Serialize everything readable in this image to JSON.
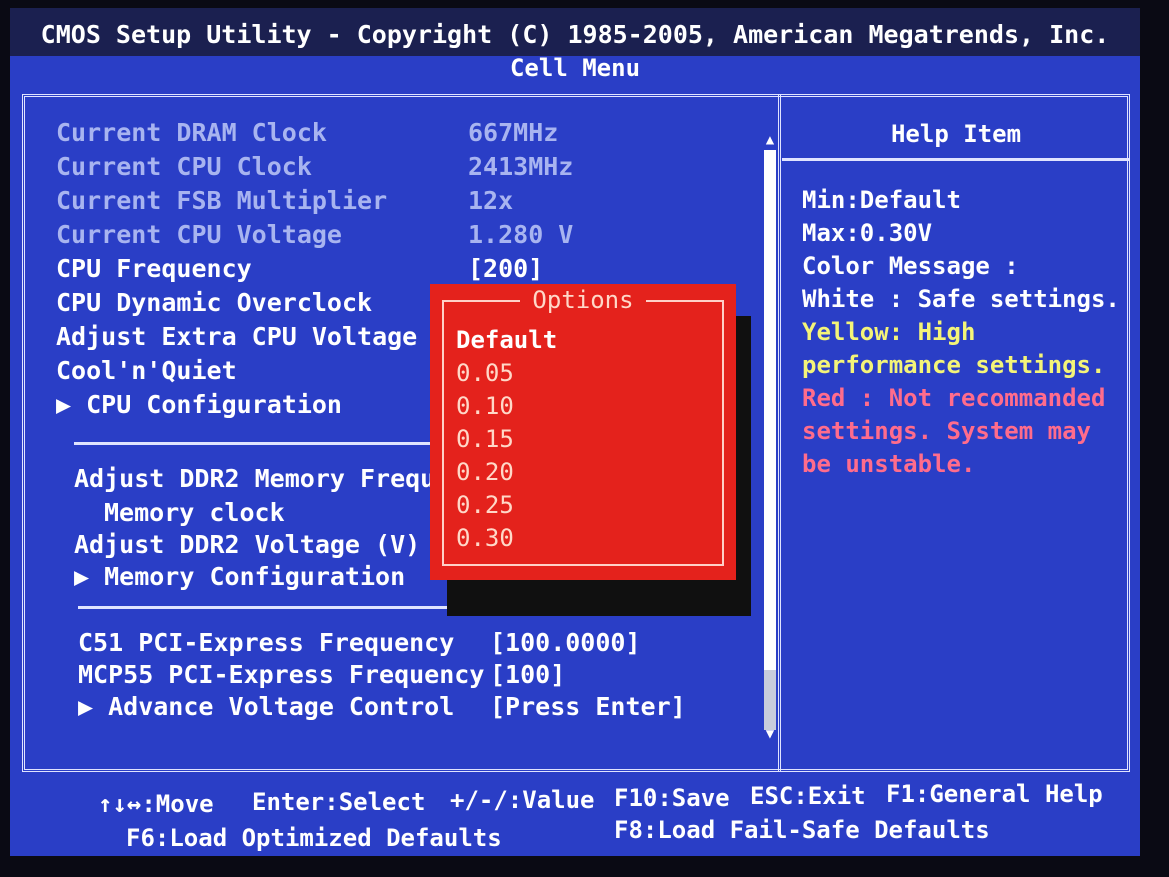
{
  "header": {
    "title": "CMOS Setup Utility - Copyright (C) 1985-2005, American Megatrends, Inc.",
    "subtitle": "Cell Menu"
  },
  "menu": {
    "info": [
      {
        "label": "Current DRAM Clock",
        "value": "667MHz"
      },
      {
        "label": "Current CPU Clock",
        "value": "2413MHz"
      },
      {
        "label": "Current FSB Multiplier",
        "value": "12x"
      },
      {
        "label": "Current CPU Voltage",
        "value": "1.280 V"
      }
    ],
    "cpu": [
      {
        "label": "CPU Frequency",
        "value": "[200]"
      },
      {
        "label": "CPU Dynamic Overclock",
        "value": ""
      },
      {
        "label": "Adjust Extra CPU Voltage",
        "value": ""
      },
      {
        "label": "Cool'n'Quiet",
        "value": ""
      },
      {
        "label": "▶ CPU Configuration",
        "value": ""
      }
    ],
    "memory": [
      {
        "label": "Adjust DDR2 Memory Frequen",
        "value": ""
      },
      {
        "label": "Memory clock",
        "value": ""
      },
      {
        "label": "Adjust DDR2 Voltage (V)",
        "value": ""
      },
      {
        "label": "▶ Memory Configuration",
        "value": ""
      }
    ],
    "pci": [
      {
        "label": "C51 PCI-Express Frequency",
        "value": "[100.0000]"
      },
      {
        "label": "MCP55 PCI-Express Frequency",
        "value": "[100]"
      },
      {
        "label": "▶ Advance Voltage Control",
        "value": "[Press Enter]"
      }
    ]
  },
  "scrollbar": {
    "up": "▲",
    "down": "▼"
  },
  "popup": {
    "title": "Options",
    "selected_index": 0,
    "items": [
      "Default",
      "0.05",
      "0.10",
      "0.15",
      "0.20",
      "0.25",
      "0.30"
    ]
  },
  "help": {
    "title": "Help Item",
    "lines": [
      {
        "text": "Min:Default",
        "color": "white"
      },
      {
        "text": "Max:0.30V",
        "color": "white"
      },
      {
        "text": "Color Message :",
        "color": "white"
      },
      {
        "text": "White : Safe settings.",
        "color": "white"
      },
      {
        "text": "Yellow: High",
        "color": "yellow"
      },
      {
        "text": "performance settings.",
        "color": "yellow"
      },
      {
        "text": "Red : Not recommanded",
        "color": "red"
      },
      {
        "text": "settings. System may",
        "color": "red"
      },
      {
        "text": "be unstable.",
        "color": "red"
      }
    ]
  },
  "footer": {
    "move": "↑↓↔:Move",
    "select": "Enter:Select",
    "value": "+/-/:Value",
    "save": "F10:Save",
    "exit": "ESC:Exit",
    "general_help": "F1:General Help",
    "optimized": "F6:Load Optimized Defaults",
    "failsafe": "F8:Load Fail-Safe Defaults"
  },
  "colors": {
    "background": "#2a3ec6",
    "popup": "#e4221c",
    "readonly_text": "#a8b4f0",
    "help_yellow": "#f4f478",
    "help_red": "#ff6c8c"
  }
}
